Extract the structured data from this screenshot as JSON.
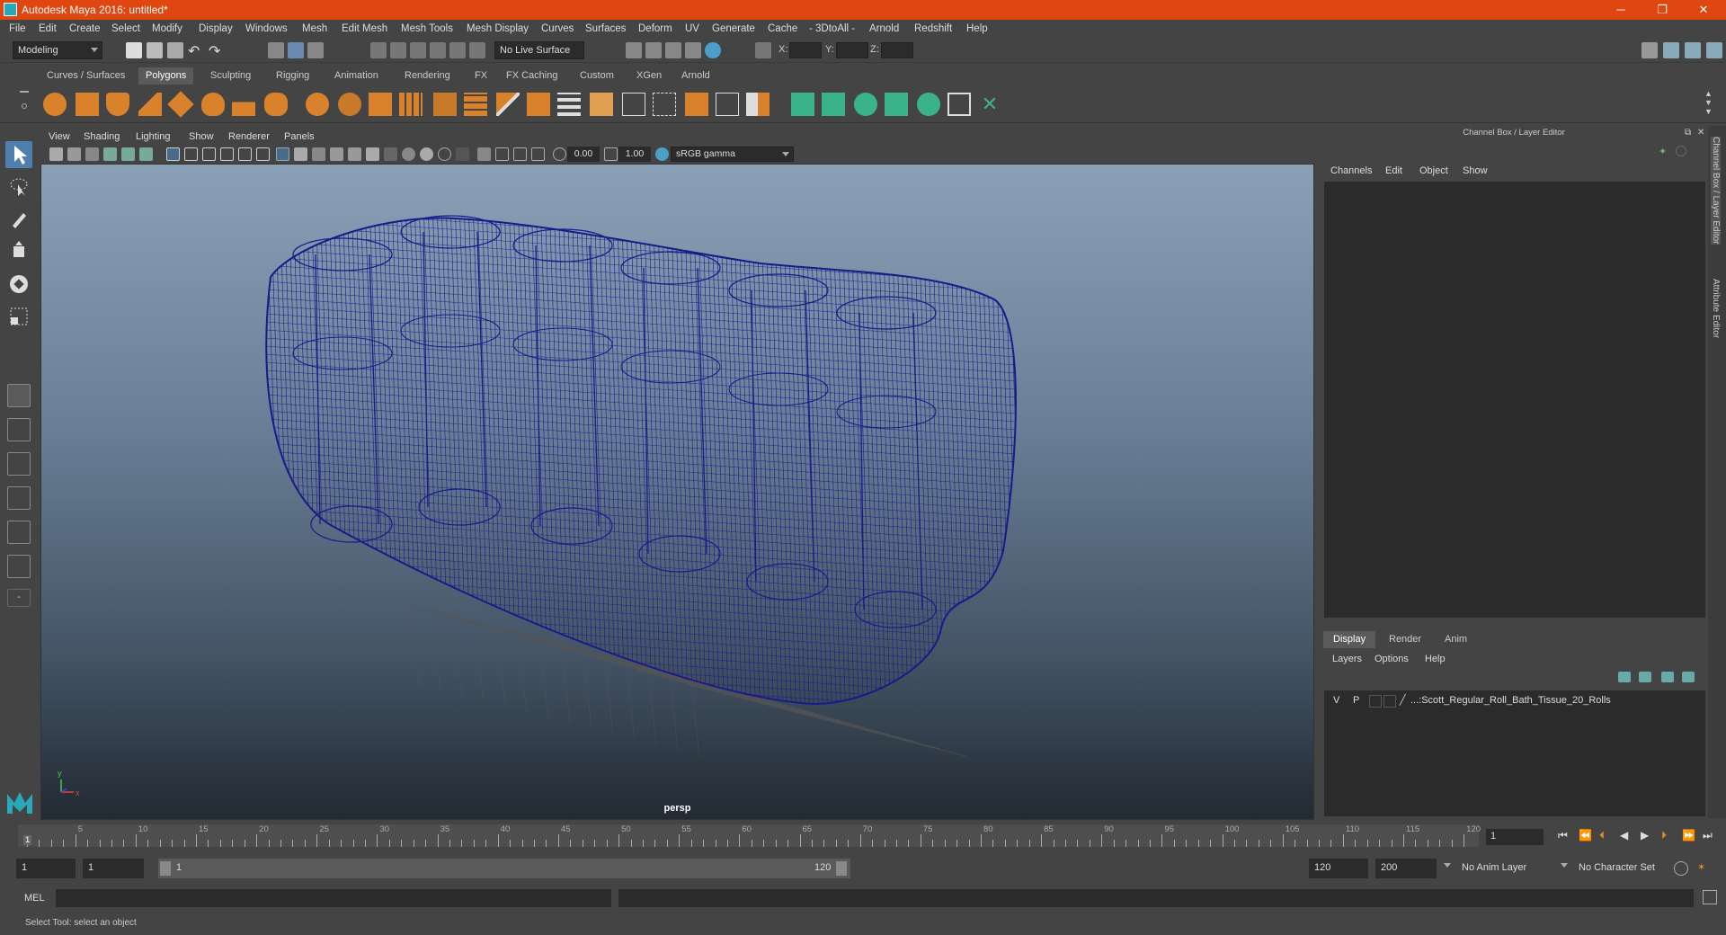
{
  "window": {
    "title": "Autodesk Maya 2016: untitled*",
    "minimize": "─",
    "restore": "❐",
    "close": "✕"
  },
  "menubar": [
    "File",
    "Edit",
    "Create",
    "Select",
    "Modify",
    "Display",
    "Windows",
    "Mesh",
    "Edit Mesh",
    "Mesh Tools",
    "Mesh Display",
    "Curves",
    "Surfaces",
    "Deform",
    "UV",
    "Generate",
    "Cache",
    "- 3DtoAll -",
    "Arnold",
    "Redshift",
    "Help"
  ],
  "statusline": {
    "mode": "Modeling",
    "live_surface": "No Live Surface",
    "x_label": "X:",
    "y_label": "Y:",
    "z_label": "Z:"
  },
  "shelf_tabs": [
    "Curves / Surfaces",
    "Polygons",
    "Sculpting",
    "Rigging",
    "Animation",
    "Rendering",
    "FX",
    "FX Caching",
    "Custom",
    "XGen",
    "Arnold"
  ],
  "shelf_active": "Polygons",
  "panel_menu": [
    "View",
    "Shading",
    "Lighting",
    "Show",
    "Renderer",
    "Panels"
  ],
  "panel_tools": {
    "exposure": "0.00",
    "gamma": "1.00",
    "color_space": "sRGB gamma"
  },
  "viewport": {
    "camera": "persp",
    "axis_y": "y",
    "axis_x": "x",
    "wire_color": "#1a1a8a"
  },
  "right_panel": {
    "header": "Channel Box / Layer Editor",
    "channel_menu": [
      "Channels",
      "Edit",
      "Object",
      "Show"
    ],
    "layer_tabs": [
      "Display",
      "Render",
      "Anim"
    ],
    "layer_active": "Display",
    "layer_menu": [
      "Layers",
      "Options",
      "Help"
    ],
    "layer": {
      "v": "V",
      "p": "P",
      "name": "...:Scott_Regular_Roll_Bath_Tissue_20_Rolls"
    },
    "side_tabs": [
      "Channel Box / Layer Editor",
      "Attribute Editor"
    ]
  },
  "timeslider": {
    "ticks": [
      5,
      10,
      15,
      20,
      25,
      30,
      35,
      40,
      45,
      50,
      55,
      60,
      65,
      70,
      75,
      80,
      85,
      90,
      95,
      100,
      105,
      110,
      115,
      120
    ],
    "current": "1",
    "current_frame_field": "1"
  },
  "range": {
    "start": "1",
    "anim_start": "1",
    "range_start": "1",
    "range_end": "120",
    "anim_end_field": "120",
    "end": "200",
    "anim_layer": "No Anim Layer",
    "char_set": "No Character Set"
  },
  "cmdline": {
    "lang": "MEL"
  },
  "helpline": {
    "text": "Select Tool: select an object"
  }
}
